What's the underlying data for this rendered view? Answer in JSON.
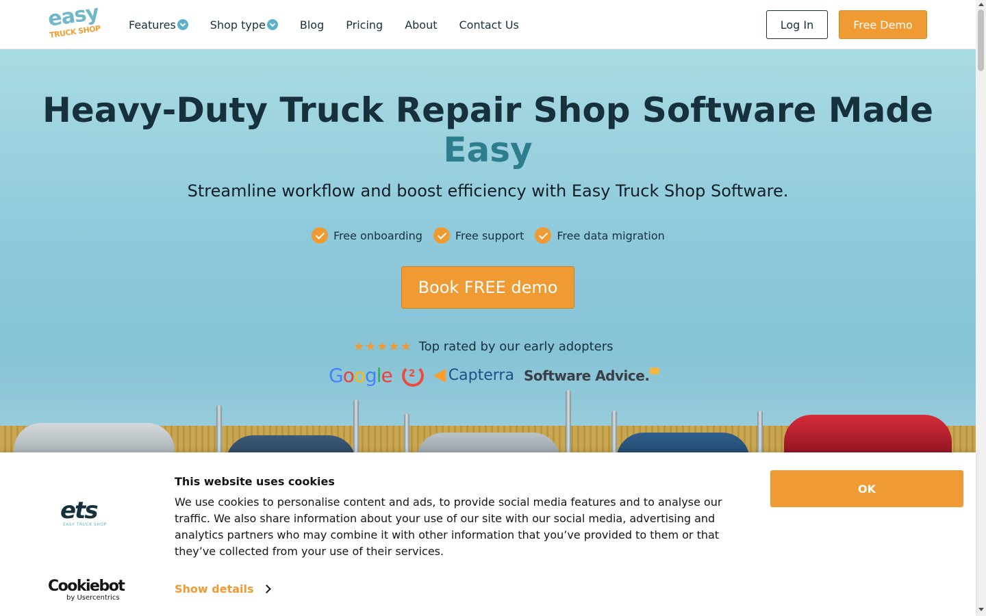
{
  "brand": {
    "logo_line1": "easy",
    "logo_line2": "TRUCK SHOP"
  },
  "nav": {
    "items": [
      {
        "label": "Features",
        "has_dropdown": true
      },
      {
        "label": "Shop type",
        "has_dropdown": true
      },
      {
        "label": "Blog",
        "has_dropdown": false
      },
      {
        "label": "Pricing",
        "has_dropdown": false
      },
      {
        "label": "About",
        "has_dropdown": false
      },
      {
        "label": "Contact Us",
        "has_dropdown": false
      }
    ],
    "login_label": "Log In",
    "demo_label": "Free Demo"
  },
  "hero": {
    "title_main": "Heavy-Duty Truck Repair Shop Software Made",
    "title_accent": "Easy",
    "subtitle": "Streamline workflow and boost efficiency with Easy Truck Shop Software.",
    "perks": [
      "Free onboarding",
      "Free support",
      "Free data migration"
    ],
    "cta_label": "Book FREE demo",
    "stars": "★★★★★",
    "rating_text": "Top rated by our early adopters",
    "review_sites": {
      "google": "Google",
      "g2": "G2",
      "capterra": "Capterra",
      "software_advice": "Software Advice."
    }
  },
  "cookie_banner": {
    "logo_text": "ets",
    "logo_subtext": "EASY TRUCK SHOP",
    "title": "This website uses cookies",
    "body": "We use cookies to personalise content and ads, to provide social media features and to analyse our traffic. We also share information about your use of our site with our social media, advertising and analytics partners who may combine it with other information that you’ve provided to them or that they’ve collected from your use of their services.",
    "details_label": "Show details",
    "ok_label": "OK",
    "provider_name": "Cookiebot",
    "provider_sub": "by Usercentrics"
  },
  "colors": {
    "accent_orange": "#f09a33",
    "brand_teal": "#5bb2c8",
    "navy_text": "#16313b",
    "accent_title": "#2e7d8e"
  }
}
